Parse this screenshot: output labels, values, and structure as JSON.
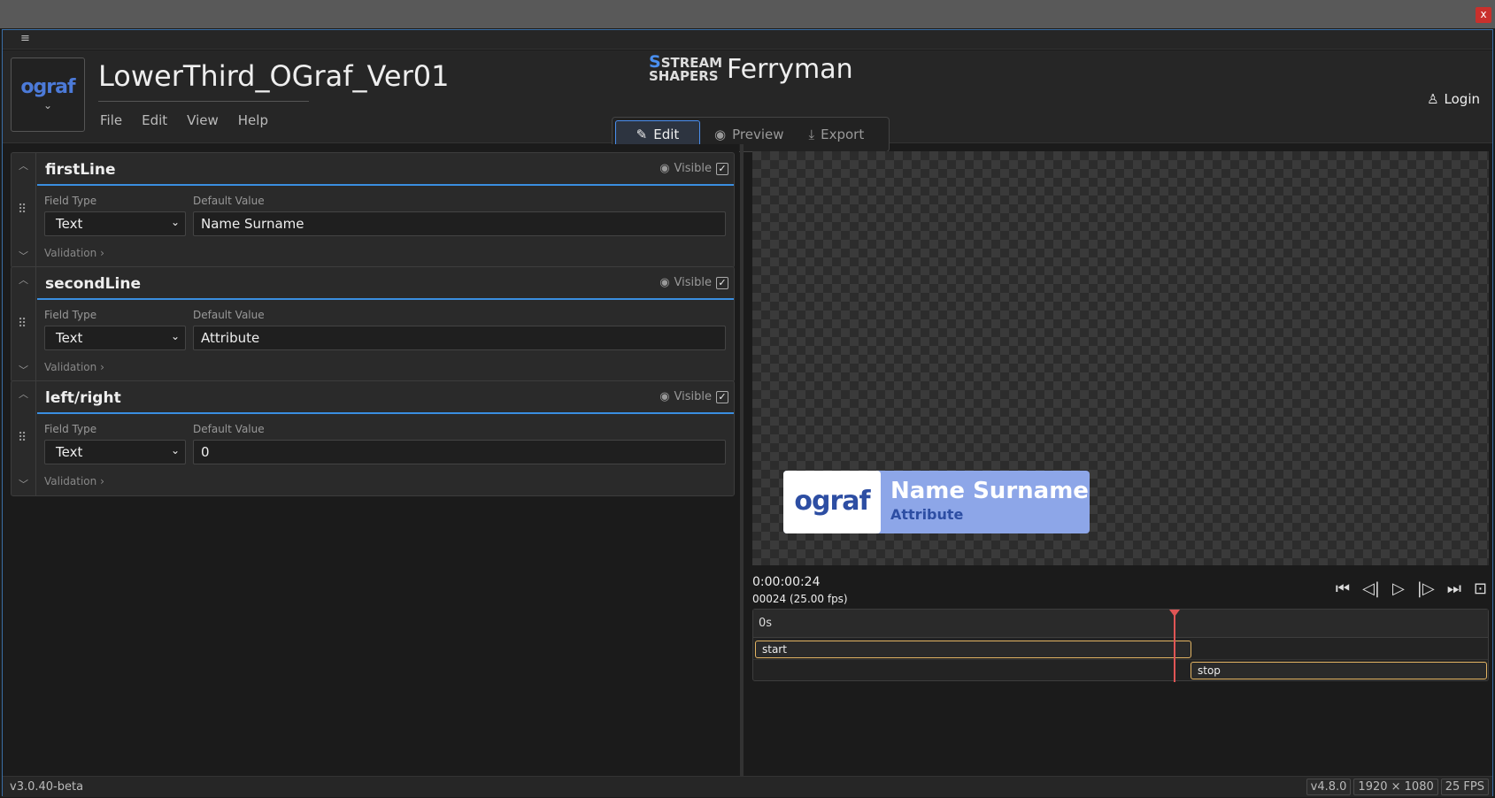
{
  "window": {
    "close_label": "x"
  },
  "header": {
    "logo_text": "ograf",
    "project_title": "LowerThird_OGraf_Ver01",
    "menu": [
      "File",
      "Edit",
      "View",
      "Help"
    ],
    "brand_logo_line1": "STREAM",
    "brand_logo_line2": "SHAPERS",
    "brand_name": "Ferryman",
    "modes": [
      {
        "label": "Edit",
        "icon": "edit-icon",
        "active": true
      },
      {
        "label": "Preview",
        "icon": "eye-icon",
        "active": false
      },
      {
        "label": "Export",
        "icon": "download-icon",
        "active": false
      }
    ],
    "login_label": "Login"
  },
  "fields": [
    {
      "name": "firstLine",
      "visible_label": "Visible",
      "type_label": "Field Type",
      "type_value": "Text",
      "default_label": "Default Value",
      "default_value": "Name Surname",
      "validation_label": "Validation"
    },
    {
      "name": "secondLine",
      "visible_label": "Visible",
      "type_label": "Field Type",
      "type_value": "Text",
      "default_label": "Default Value",
      "default_value": "Attribute",
      "validation_label": "Validation"
    },
    {
      "name": "left/right",
      "visible_label": "Visible",
      "type_label": "Field Type",
      "type_value": "Text",
      "default_label": "Default Value",
      "default_value": "0",
      "validation_label": "Validation"
    }
  ],
  "preview": {
    "logo_text": "ograf",
    "name": "Name Surname",
    "attribute": "Attribute"
  },
  "playback": {
    "timecode": "0:00:00:24",
    "frames": "00024 (25.00 fps)"
  },
  "timeline": {
    "ruler_label": "0s",
    "clips": [
      "start",
      "stop"
    ]
  },
  "status": {
    "version": "v3.0.40-beta",
    "chips": [
      "v4.8.0",
      "1920 × 1080",
      "25 FPS"
    ]
  },
  "colors": {
    "accent": "#3a8ee0",
    "clip_border": "#e3b463",
    "playhead": "#e05555",
    "lt_bg": "#8da6e8"
  }
}
